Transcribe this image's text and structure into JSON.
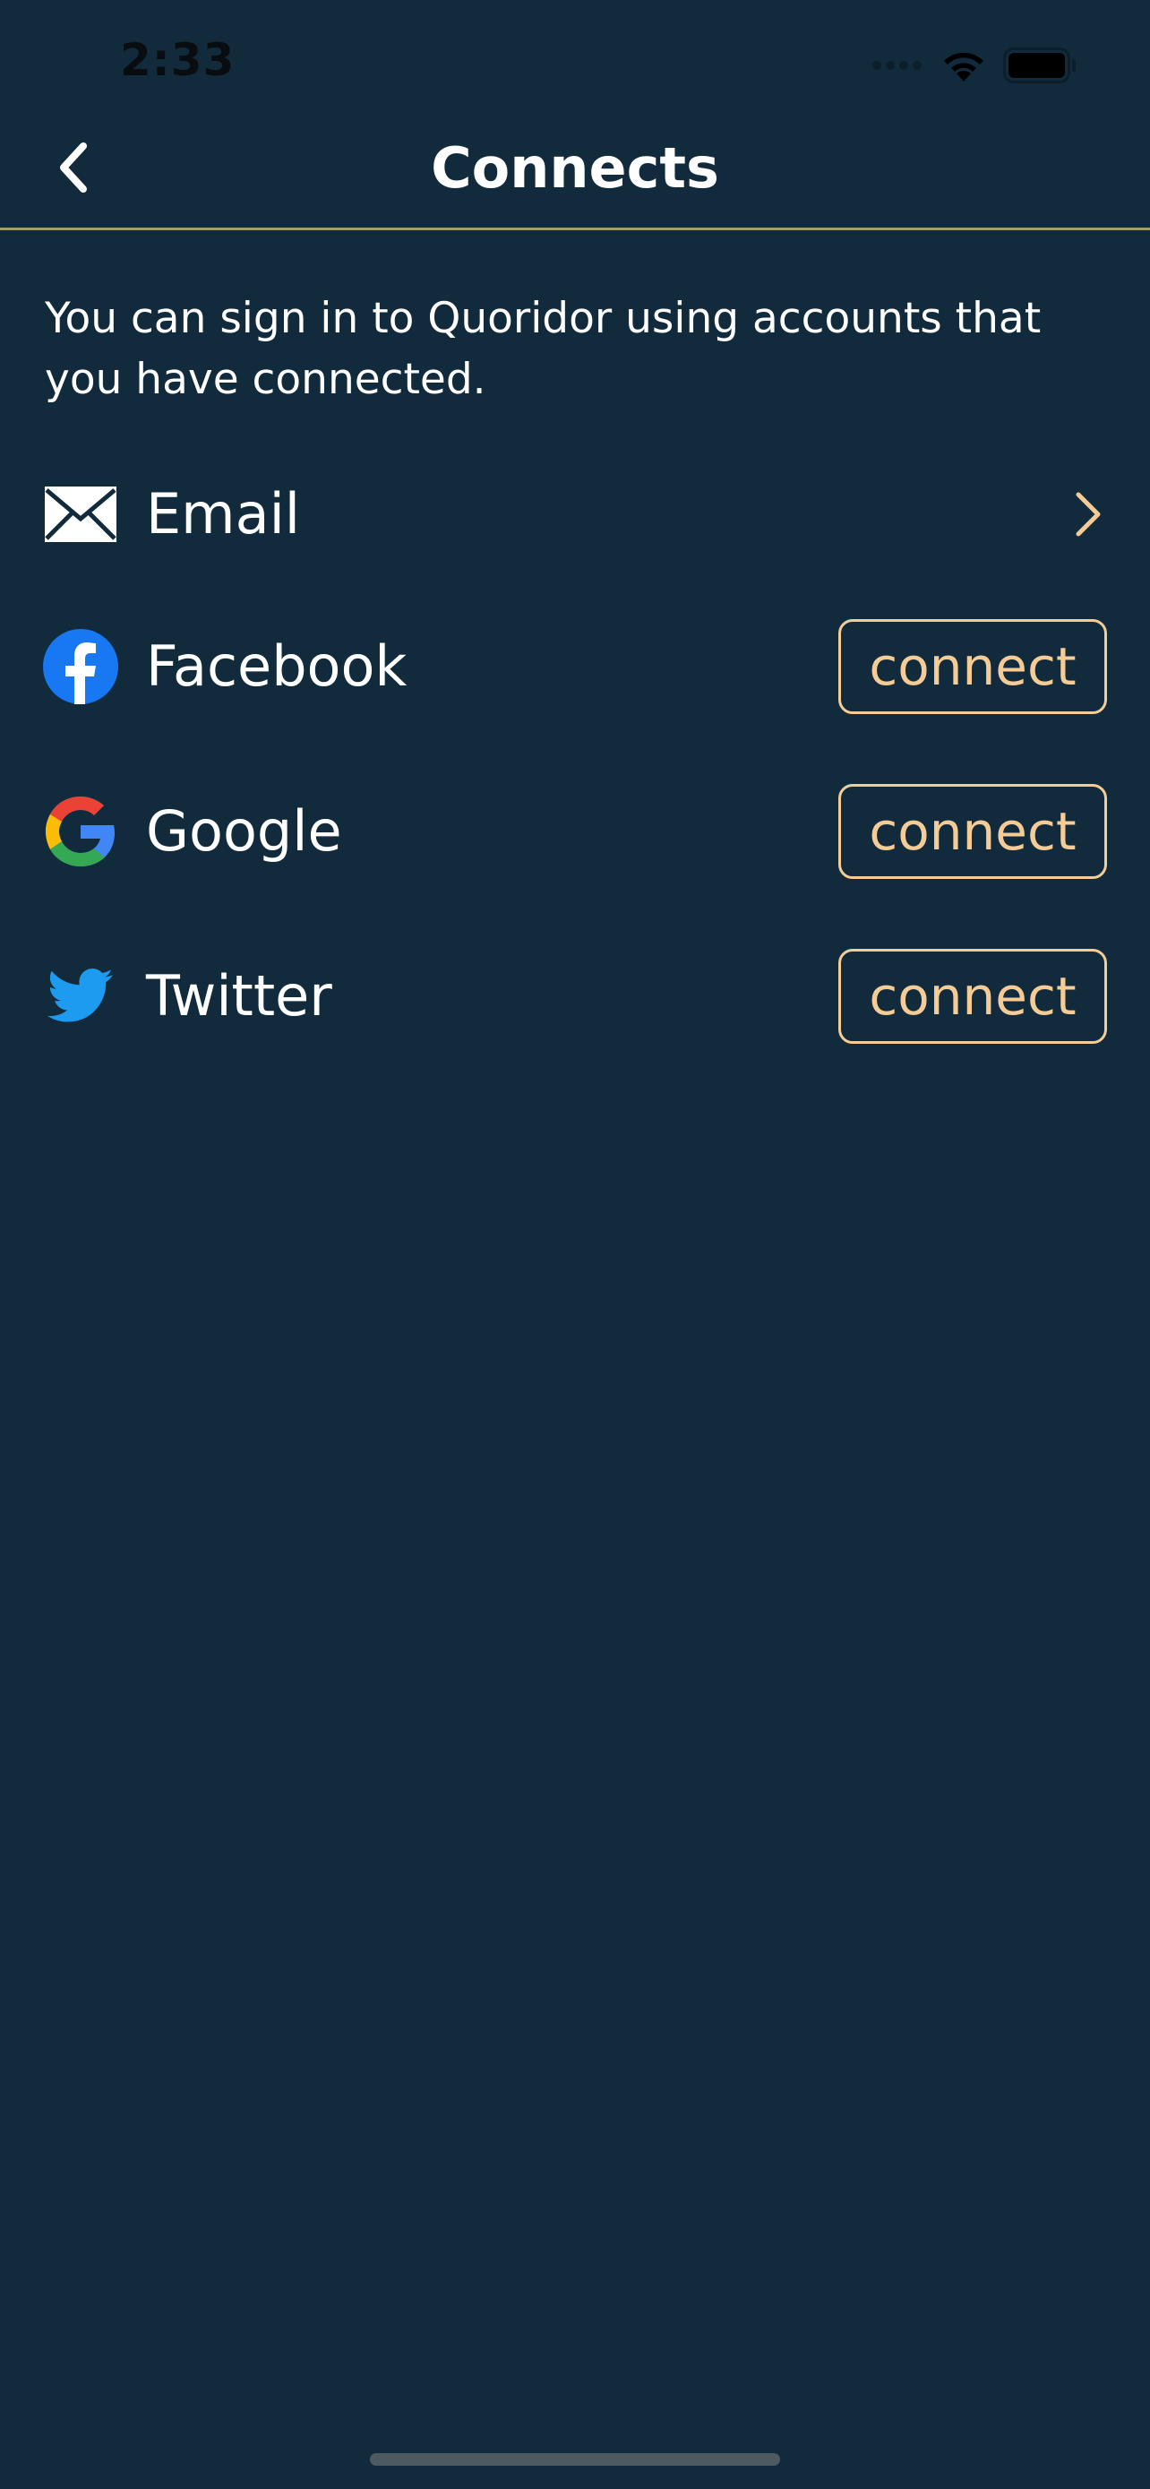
{
  "status_bar": {
    "time": "2:33"
  },
  "nav": {
    "title": "Connects"
  },
  "description": "You can sign in to Quoridor using accounts that you have connected.",
  "accounts": [
    {
      "label": "Email",
      "icon": "mail-icon",
      "action": "chevron-right-icon"
    },
    {
      "label": "Facebook",
      "icon": "facebook-icon",
      "action_label": "connect"
    },
    {
      "label": "Google",
      "icon": "google-icon",
      "action_label": "connect"
    },
    {
      "label": "Twitter",
      "icon": "twitter-icon",
      "action_label": "connect"
    }
  ],
  "colors": {
    "background": "#112b3c",
    "accent": "#f5cc96",
    "divider": "#a89a6e",
    "facebook": "#1877f2",
    "twitter": "#1d9bf0"
  }
}
